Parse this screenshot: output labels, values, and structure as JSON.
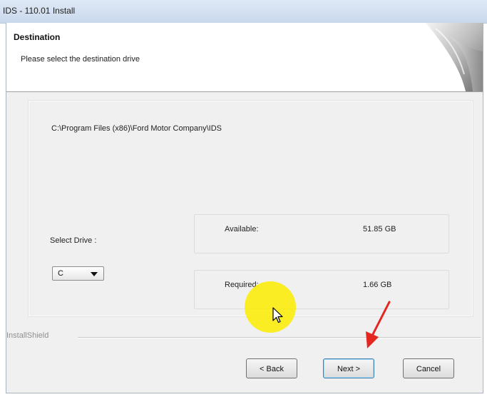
{
  "window": {
    "title": "IDS - 110.01 Install"
  },
  "header": {
    "title": "Destination",
    "subtitle": "Please select the destination drive",
    "logo_icon": "installshield-curl-logo"
  },
  "destination": {
    "path": "C:\\Program Files (x86)\\Ford Motor Company\\IDS",
    "select_drive_label": "Select Drive :",
    "selected_drive": "C"
  },
  "space": {
    "available_label": "Available:",
    "available_value": "51.85 GB",
    "required_label": "Required:",
    "required_value": "1.66 GB"
  },
  "footer": {
    "brand": "InstallShield",
    "back_label": "< Back",
    "next_label": "Next >",
    "cancel_label": "Cancel"
  },
  "overlay": {
    "highlight_color": "#fcec00",
    "annotation_arrow_color": "#e3261f",
    "cursor_icon": "mouse-pointer-icon"
  }
}
